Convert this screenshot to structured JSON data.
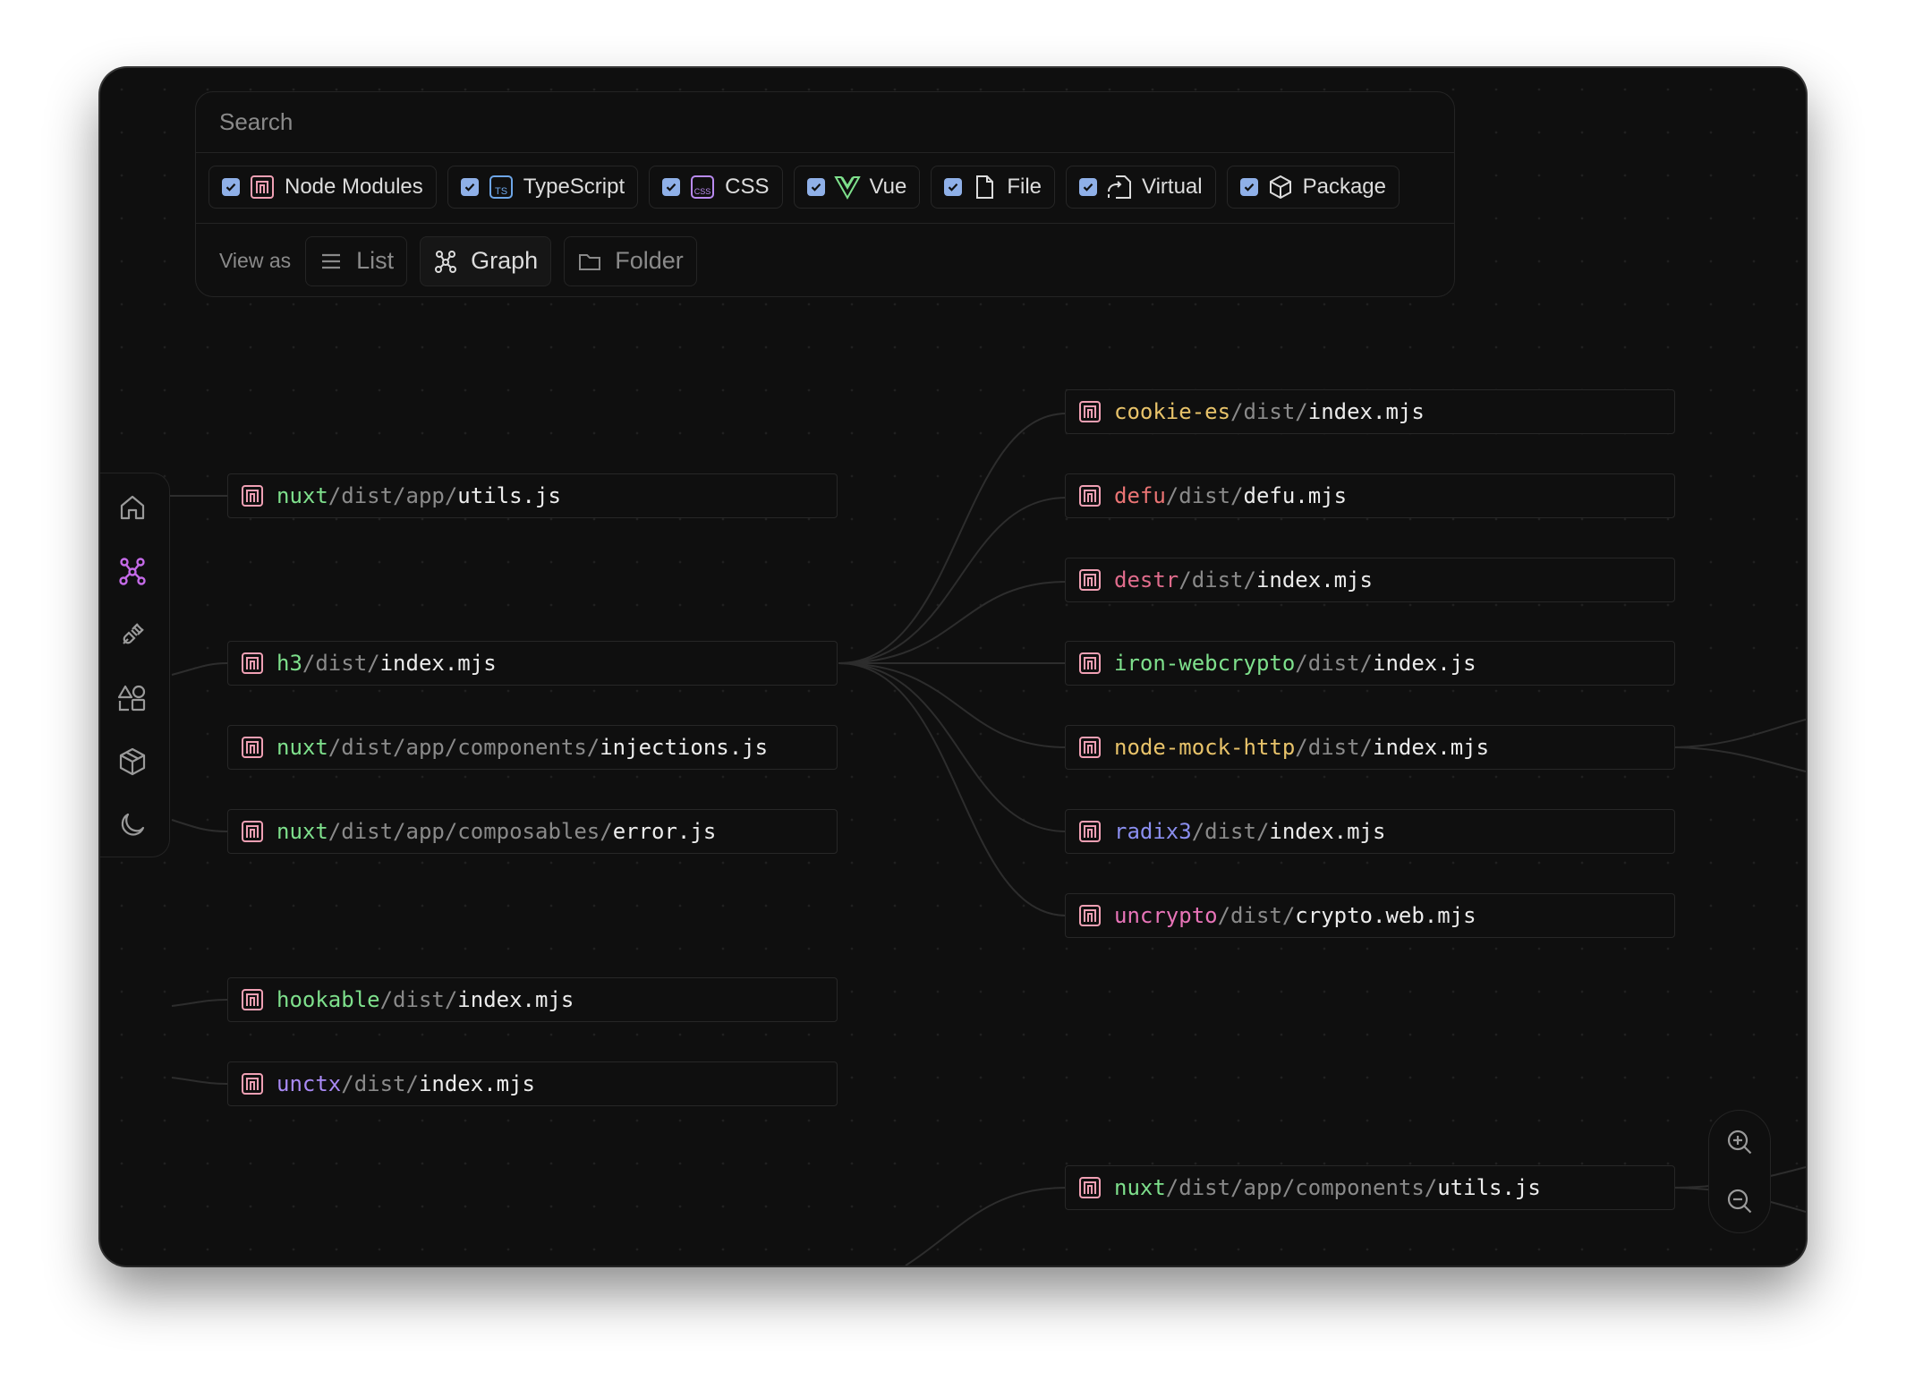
{
  "search": {
    "placeholder": "Search"
  },
  "filters": [
    {
      "label": "Node Modules",
      "checked": true,
      "icon": "node-modules-icon"
    },
    {
      "label": "TypeScript",
      "checked": true,
      "icon": "typescript-icon"
    },
    {
      "label": "CSS",
      "checked": true,
      "icon": "css-icon"
    },
    {
      "label": "Vue",
      "checked": true,
      "icon": "vue-icon"
    },
    {
      "label": "File",
      "checked": true,
      "icon": "file-icon"
    },
    {
      "label": "Virtual",
      "checked": true,
      "icon": "virtual-icon"
    },
    {
      "label": "Package",
      "checked": true,
      "icon": "package-icon"
    }
  ],
  "view": {
    "label": "View as",
    "options": [
      {
        "label": "List",
        "icon": "list-icon",
        "active": false
      },
      {
        "label": "Graph",
        "icon": "graph-icon",
        "active": true
      },
      {
        "label": "Folder",
        "icon": "folder-icon",
        "active": false
      }
    ]
  },
  "sidebar": [
    {
      "name": "home-icon"
    },
    {
      "name": "graph-icon",
      "active": true
    },
    {
      "name": "plugin-icon"
    },
    {
      "name": "shapes-icon"
    },
    {
      "name": "package-icon"
    },
    {
      "name": "dark-mode-moon-icon"
    }
  ],
  "nodes": {
    "left": [
      {
        "pkg": "nuxt",
        "color": "#7ee08c",
        "mid": "dist/app/",
        "file": "utils.js"
      },
      {
        "pkg": "h3",
        "color": "#7ee08c",
        "mid": "dist/",
        "file": "index.mjs"
      },
      {
        "pkg": "nuxt",
        "color": "#7ee08c",
        "mid": "dist/app/components/",
        "file": "injections.js"
      },
      {
        "pkg": "nuxt",
        "color": "#7ee08c",
        "mid": "dist/app/composables/",
        "file": "error.js"
      },
      {
        "pkg": "hookable",
        "color": "#7ee08c",
        "mid": "dist/",
        "file": "index.mjs"
      },
      {
        "pkg": "unctx",
        "color": "#a98af5",
        "mid": "dist/",
        "file": "index.mjs"
      }
    ],
    "right": [
      {
        "pkg": "cookie-es",
        "color": "#e8c36a",
        "mid": "dist/",
        "file": "index.mjs"
      },
      {
        "pkg": "defu",
        "color": "#ea7474",
        "mid": "dist/",
        "file": "defu.mjs"
      },
      {
        "pkg": "destr",
        "color": "#e06c8c",
        "mid": "dist/",
        "file": "index.mjs"
      },
      {
        "pkg": "iron-webcrypto",
        "color": "#7ee08c",
        "mid": "dist/",
        "file": "index.js"
      },
      {
        "pkg": "node-mock-http",
        "color": "#e8c36a",
        "mid": "dist/",
        "file": "index.mjs"
      },
      {
        "pkg": "radix3",
        "color": "#8b8ff0",
        "mid": "dist/",
        "file": "index.mjs"
      },
      {
        "pkg": "uncrypto",
        "color": "#e874b8",
        "mid": "dist/",
        "file": "crypto.web.mjs"
      },
      {
        "pkg": "nuxt",
        "color": "#7ee08c",
        "mid": "dist/app/components/",
        "file": "utils.js"
      }
    ]
  },
  "zoom": [
    {
      "name": "zoom-in-icon"
    },
    {
      "name": "zoom-out-icon"
    }
  ],
  "colors": {
    "accent": "#c56be8",
    "checkbox": "#8fb0e8",
    "node_icon": "#f0a0b4"
  }
}
